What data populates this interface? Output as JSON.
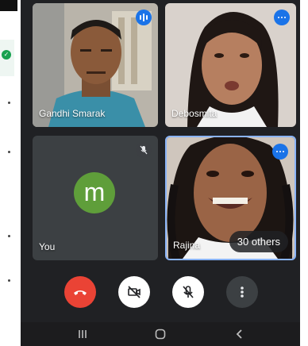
{
  "participants": [
    {
      "name": "Gandhi Smarak"
    },
    {
      "name": "Debosmita"
    },
    {
      "name": "You",
      "avatar_letter": "m"
    },
    {
      "name": "Rajina"
    }
  ],
  "others_chip": "30 others",
  "colors": {
    "end_call": "#ea4335",
    "speaking_badge": "#1a73e8",
    "avatar": "#5f9e3a",
    "active_border": "#8ab4f8"
  },
  "icons": {
    "end_call": "phone-hangup-icon",
    "camera": "camera-off-icon",
    "mic": "mic-off-icon",
    "more": "more-vertical-icon"
  }
}
